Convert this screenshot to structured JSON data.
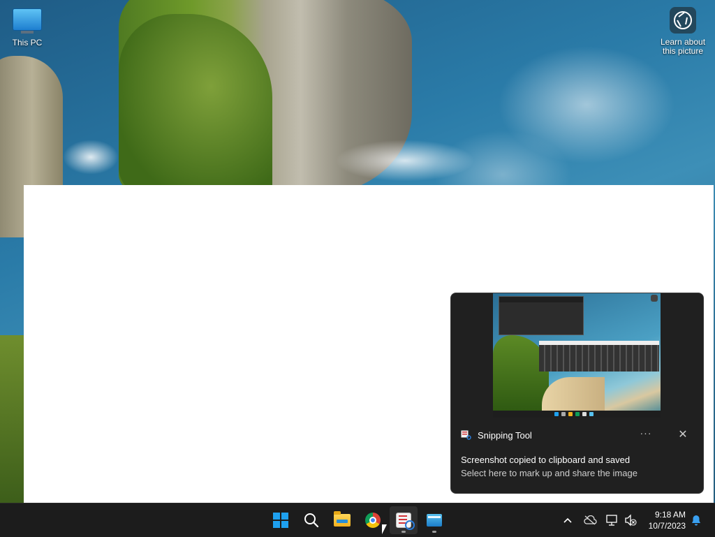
{
  "desktop": {
    "icons": [
      {
        "label": "This PC",
        "icon": "monitor-icon"
      },
      {
        "label": "Learn about this picture",
        "icon": "camera-lens-icon"
      }
    ]
  },
  "notification": {
    "app_name": "Snipping Tool",
    "app_icon": "snipping-tool-icon",
    "title": "Screenshot copied to clipboard and saved",
    "body": "Select here to mark up and share the image",
    "more_label": "···",
    "close_label": "✕"
  },
  "taskbar": {
    "apps": [
      {
        "name": "Start",
        "icon": "windows-logo-icon"
      },
      {
        "name": "Search",
        "icon": "search-icon"
      },
      {
        "name": "File Explorer",
        "icon": "folder-icon"
      },
      {
        "name": "Google Chrome",
        "icon": "chrome-icon"
      },
      {
        "name": "Snipping Tool",
        "icon": "snipping-tool-icon",
        "active": true
      },
      {
        "name": "Remote Desktop",
        "icon": "remote-desktop-icon"
      }
    ],
    "tray": {
      "chevron": "^",
      "icons": [
        "onedrive-offline-icon",
        "network-icon",
        "volume-muted-icon",
        "notifications-icon"
      ]
    },
    "clock": {
      "time": "9:18 AM",
      "date": "10/7/2023"
    }
  },
  "colors": {
    "taskbar_bg": "#1c1c1c",
    "toast_bg": "#202020",
    "accent": "#1ea0ef"
  }
}
